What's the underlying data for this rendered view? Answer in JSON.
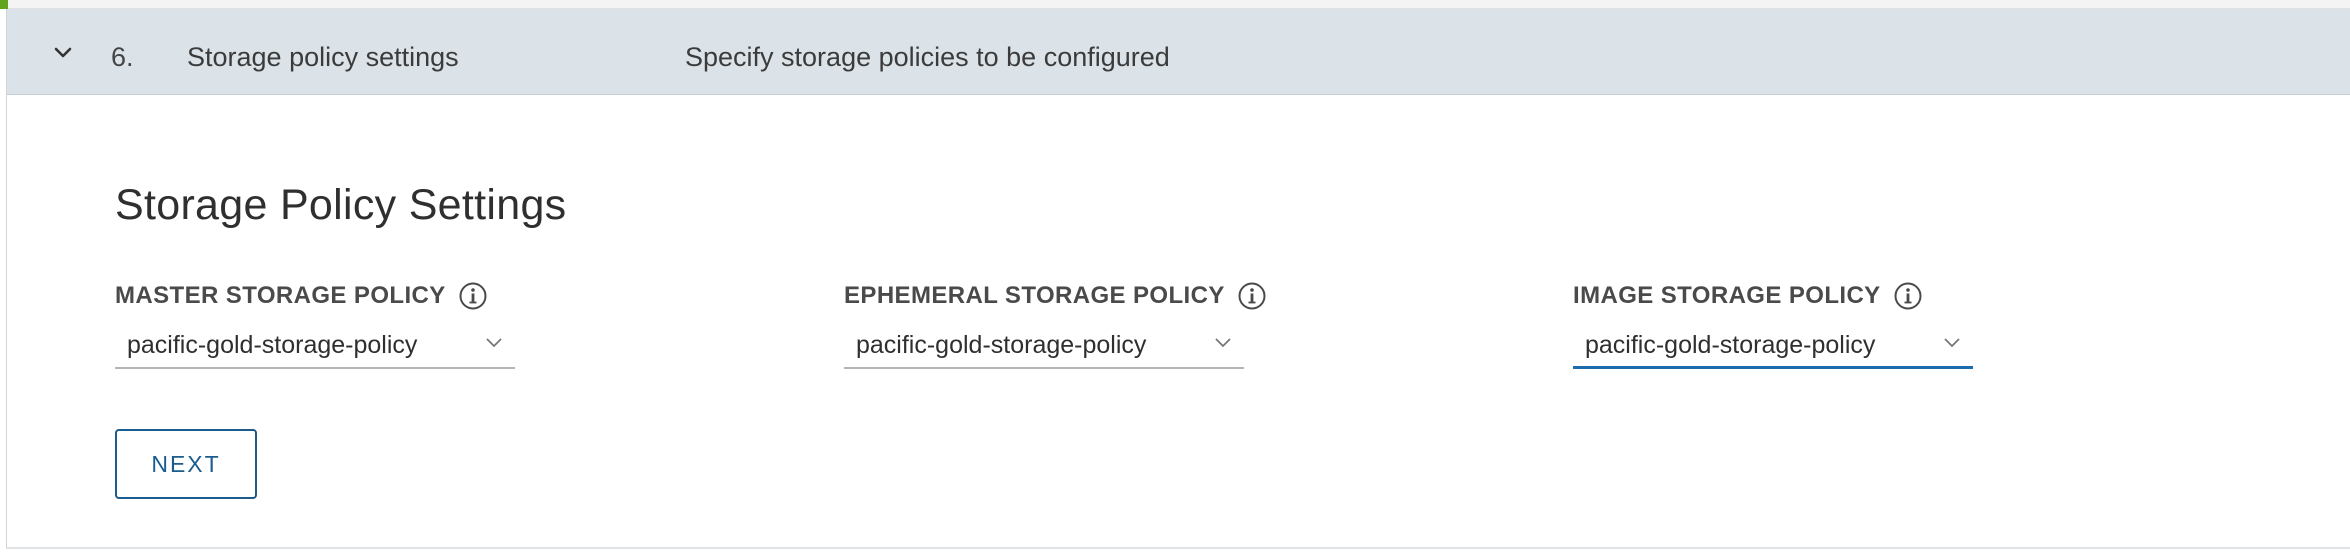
{
  "colors": {
    "header_bg": "#dbe3e8",
    "accent": "#62a420",
    "primary": "#1b5c8f",
    "active_underline": "#1c6bad"
  },
  "step": {
    "expand_icon": "chevron-down-icon",
    "number": "6.",
    "title": "Storage policy settings",
    "description": "Specify storage policies to be configured"
  },
  "section": {
    "title": "Storage Policy Settings"
  },
  "fields": [
    {
      "label": "MASTER STORAGE POLICY",
      "info_icon": "info-icon",
      "value": "pacific-gold-storage-policy"
    },
    {
      "label": "EPHEMERAL STORAGE POLICY",
      "info_icon": "info-icon",
      "value": "pacific-gold-storage-policy"
    },
    {
      "label": "IMAGE STORAGE POLICY",
      "info_icon": "info-icon",
      "value": "pacific-gold-storage-policy",
      "focused": true
    }
  ],
  "actions": {
    "next_label": "NEXT"
  }
}
